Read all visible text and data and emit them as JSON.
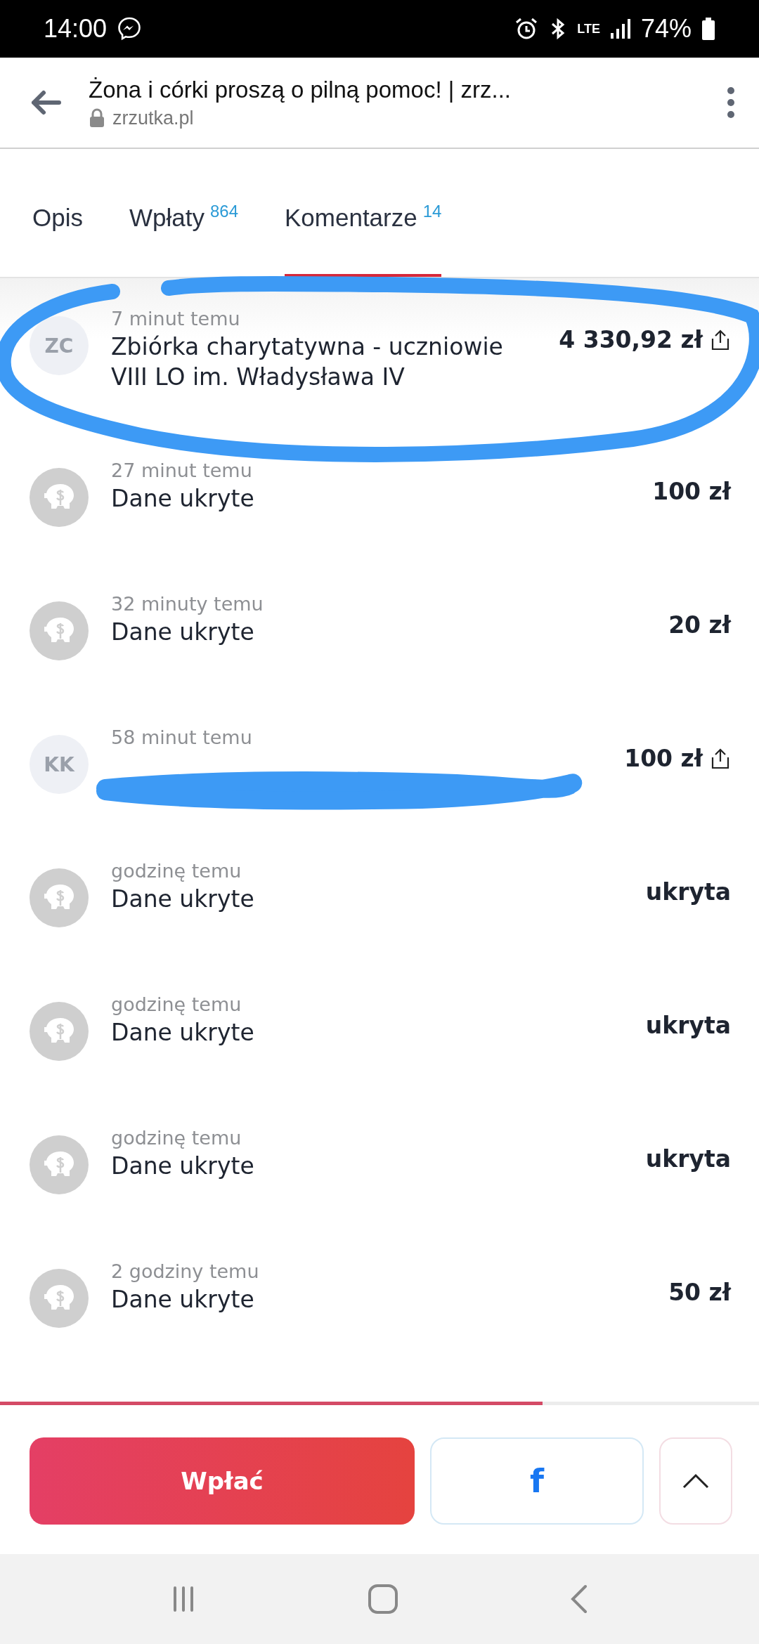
{
  "status_bar": {
    "time": "14:00",
    "network": "LTE",
    "battery": "74%"
  },
  "browser": {
    "title": "Żona i córki proszą o pilną pomoc! | zrz...",
    "url": "zrzutka.pl"
  },
  "tabs": [
    {
      "label": "Opis",
      "selected": false
    },
    {
      "label": "Wpłaty",
      "count": "864",
      "selected": false
    },
    {
      "label": "Komentarze",
      "count": "14",
      "selected": true
    }
  ],
  "donations": [
    {
      "avatar": {
        "kind": "initials",
        "text": "ZC"
      },
      "time": "7 minut temu",
      "name": "Zbiórka charytatywna - uczniowie VIII LO im. Władysława IV",
      "amount": "4 330,92 zł",
      "shareable": true,
      "highlighted": true
    },
    {
      "avatar": {
        "kind": "anonymous"
      },
      "time": "27 minut temu",
      "name": "Dane ukryte",
      "amount": "100 zł",
      "shareable": false,
      "highlighted": false
    },
    {
      "avatar": {
        "kind": "anonymous"
      },
      "time": "32 minuty temu",
      "name": "Dane ukryte",
      "amount": "20 zł",
      "shareable": false,
      "highlighted": false
    },
    {
      "avatar": {
        "kind": "initials",
        "text": "KK"
      },
      "time": "58 minut temu",
      "amount": "100 zł",
      "shareable": true,
      "highlighted": false
    },
    {
      "avatar": {
        "kind": "anonymous"
      },
      "time": "godzinę temu",
      "name": "Dane ukryte",
      "amount": "ukryta",
      "shareable": false,
      "highlighted": false
    },
    {
      "avatar": {
        "kind": "anonymous"
      },
      "time": "godzinę temu",
      "name": "Dane ukryte",
      "amount": "ukryta",
      "shareable": false,
      "highlighted": false
    },
    {
      "avatar": {
        "kind": "anonymous"
      },
      "time": "godzinę temu",
      "name": "Dane ukryte",
      "amount": "ukryta",
      "shareable": false,
      "highlighted": false
    },
    {
      "avatar": {
        "kind": "anonymous"
      },
      "time": "2 godziny temu",
      "name": "Dane ukryte",
      "amount": "50 zł",
      "shareable": false,
      "highlighted": false
    }
  ],
  "scroll_progress": {
    "level": 0.715
  },
  "actions": {
    "donate": "Wpłać",
    "facebook": "f"
  },
  "scribbles": {
    "loop": true,
    "strike": true
  }
}
